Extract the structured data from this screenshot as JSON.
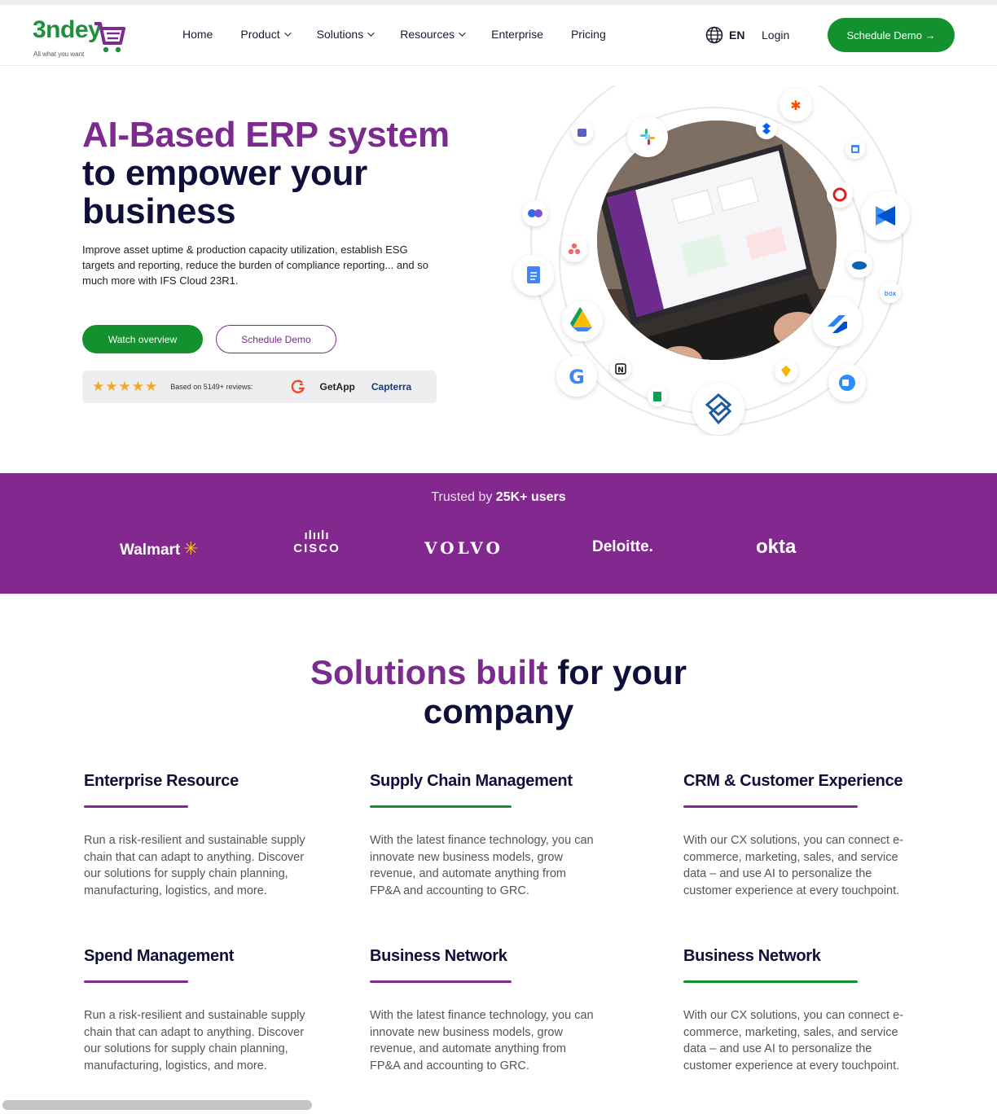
{
  "nav": {
    "logo_text": "3ndey",
    "logo_tagline": "All what you want",
    "links": [
      {
        "label": "Home",
        "dropdown": false
      },
      {
        "label": "Product",
        "dropdown": true
      },
      {
        "label": "Solutions",
        "dropdown": true
      },
      {
        "label": "Resources",
        "dropdown": true
      },
      {
        "label": "Enterprise",
        "dropdown": false
      },
      {
        "label": "Pricing",
        "dropdown": false
      }
    ],
    "language": "EN",
    "login": "Login",
    "cta": "Schedule Demo →"
  },
  "hero": {
    "title_accent": "AI-Based ERP system",
    "title_rest": "to empower your business",
    "description": "Improve asset uptime & production capacity utilization, establish ESG targets and reporting, reduce the burden of compliance reporting... and so much more with IFS Cloud 23R1.",
    "watch_button": "Watch overview",
    "demo_button": "Schedule Demo",
    "reviews": {
      "stars": "★★★★★",
      "rating": 4.5,
      "text": "Based on 5149+ reviews:",
      "platforms": [
        "G2",
        "GetApp",
        "Capterra"
      ]
    },
    "integration_icons": [
      "teams-icon",
      "slack-icon",
      "dropbox-icon",
      "zapier-icon",
      "calendar-icon",
      "creative-cloud-icon",
      "confluence-icon",
      "onedrive-icon",
      "box-icon",
      "jira-icon",
      "zoom-icon",
      "sketch-icon",
      "notion-icon",
      "google-icon",
      "sheets-icon",
      "drive-icon",
      "docs-icon",
      "asana-icon",
      "copilot-icon",
      "app-logo-icon"
    ]
  },
  "trusted": {
    "prefix": "Trusted by",
    "highlight": "25K+ users",
    "brands": [
      "Walmart",
      "CISCO",
      "VOLVO",
      "Deloitte.",
      "okta"
    ]
  },
  "solutions": {
    "title_accent": "Solutions built",
    "title_rest1": "for your",
    "title_rest2": "company",
    "cards": [
      {
        "title": "Enterprise Resource",
        "accent": "#7b2a8e",
        "text": "Run a risk-resilient and sustainable supply chain that can adapt to anything. Discover our solutions for supply chain planning, manufacturing, logistics, and more."
      },
      {
        "title": "Supply Chain Management",
        "accent": "#14912f",
        "text": "With the latest finance technology, you can innovate new business models, grow revenue, and automate anything from FP&A and accounting to GRC."
      },
      {
        "title": "CRM & Customer Experience",
        "accent": "#7b2a8e",
        "text": "With our CX solutions, you can connect e-commerce, marketing, sales, and service data – and use AI to personalize the customer experience at every touchpoint."
      },
      {
        "title": "Spend Management",
        "accent": "#7b2a8e",
        "text": "Run a risk-resilient and sustainable supply chain that can adapt to anything. Discover our solutions for supply chain planning, manufacturing, logistics, and more."
      },
      {
        "title": "Business Network",
        "accent": "#7b2a8e",
        "text": "With the latest finance technology, you can innovate new business models, grow revenue, and automate anything from FP&A and accounting to GRC."
      },
      {
        "title": "Business Network",
        "accent": "#14912f",
        "text": "With our CX solutions, you can connect e-commerce, marketing, sales, and service data – and use AI to personalize the customer experience at every touchpoint."
      }
    ]
  }
}
